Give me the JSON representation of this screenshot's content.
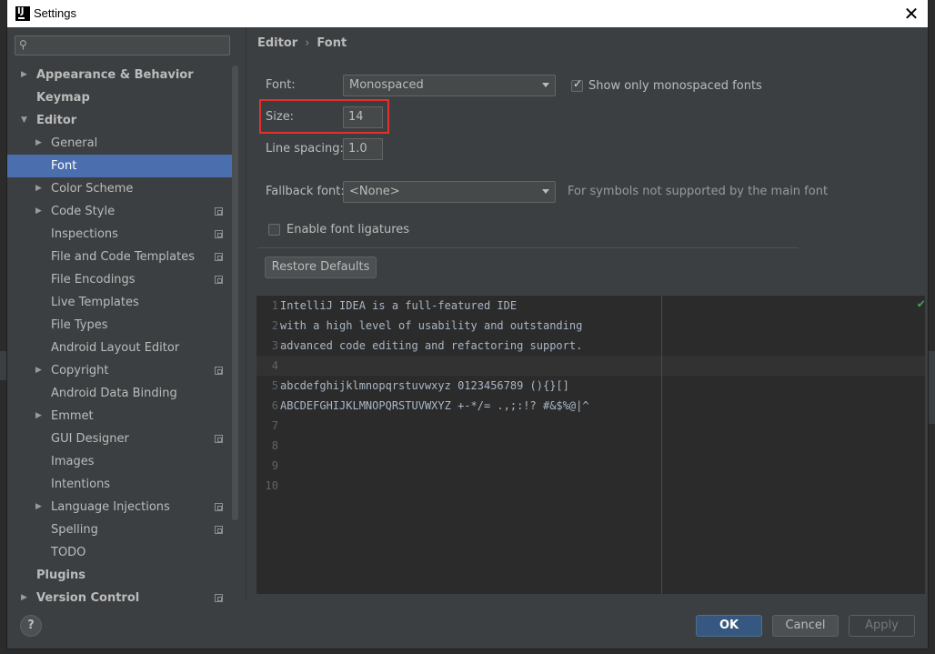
{
  "window": {
    "title": "Settings"
  },
  "sidebar": {
    "search_placeholder": "",
    "items": [
      {
        "label": "Appearance & Behavior",
        "level": 0,
        "expandable": true,
        "expanded": false,
        "bold": true,
        "project_icon": false
      },
      {
        "label": "Keymap",
        "level": 0,
        "expandable": false,
        "bold": true,
        "project_icon": false
      },
      {
        "label": "Editor",
        "level": 0,
        "expandable": true,
        "expanded": true,
        "bold": true,
        "project_icon": false
      },
      {
        "label": "General",
        "level": 1,
        "expandable": true,
        "project_icon": false
      },
      {
        "label": "Font",
        "level": 1,
        "expandable": false,
        "selected": true,
        "project_icon": false
      },
      {
        "label": "Color Scheme",
        "level": 1,
        "expandable": true,
        "project_icon": false
      },
      {
        "label": "Code Style",
        "level": 1,
        "expandable": true,
        "project_icon": true
      },
      {
        "label": "Inspections",
        "level": 1,
        "expandable": false,
        "project_icon": true
      },
      {
        "label": "File and Code Templates",
        "level": 1,
        "expandable": false,
        "project_icon": true
      },
      {
        "label": "File Encodings",
        "level": 1,
        "expandable": false,
        "project_icon": true
      },
      {
        "label": "Live Templates",
        "level": 1,
        "expandable": false,
        "project_icon": false
      },
      {
        "label": "File Types",
        "level": 1,
        "expandable": false,
        "project_icon": false
      },
      {
        "label": "Android Layout Editor",
        "level": 1,
        "expandable": false,
        "project_icon": false
      },
      {
        "label": "Copyright",
        "level": 1,
        "expandable": true,
        "project_icon": true
      },
      {
        "label": "Android Data Binding",
        "level": 1,
        "expandable": false,
        "project_icon": false
      },
      {
        "label": "Emmet",
        "level": 1,
        "expandable": true,
        "project_icon": false
      },
      {
        "label": "GUI Designer",
        "level": 1,
        "expandable": false,
        "project_icon": true
      },
      {
        "label": "Images",
        "level": 1,
        "expandable": false,
        "project_icon": false
      },
      {
        "label": "Intentions",
        "level": 1,
        "expandable": false,
        "project_icon": false
      },
      {
        "label": "Language Injections",
        "level": 1,
        "expandable": true,
        "project_icon": true
      },
      {
        "label": "Spelling",
        "level": 1,
        "expandable": false,
        "project_icon": true
      },
      {
        "label": "TODO",
        "level": 1,
        "expandable": false,
        "project_icon": false
      },
      {
        "label": "Plugins",
        "level": 0,
        "expandable": false,
        "bold": true,
        "project_icon": false
      },
      {
        "label": "Version Control",
        "level": 0,
        "expandable": true,
        "bold": true,
        "project_icon": true
      }
    ]
  },
  "breadcrumb": {
    "parent": "Editor",
    "separator": "›",
    "current": "Font"
  },
  "font_settings": {
    "font_label": "Font:",
    "font_value": "Monospaced",
    "show_monospaced_label": "Show only monospaced fonts",
    "show_monospaced_checked": true,
    "size_label": "Size:",
    "size_value": "14",
    "line_spacing_label": "Line spacing:",
    "line_spacing_value": "1.0",
    "fallback_label": "Fallback font:",
    "fallback_value": "<None>",
    "fallback_hint": "For symbols not supported by the main font",
    "ligatures_label": "Enable font ligatures",
    "ligatures_checked": false,
    "restore_label": "Restore Defaults"
  },
  "preview": {
    "line_numbers": [
      "1",
      "2",
      "3",
      "4",
      "5",
      "6",
      "7",
      "8",
      "9",
      "10"
    ],
    "lines": [
      "IntelliJ IDEA is a full-featured IDE",
      "with a high level of usability and outstanding",
      "advanced code editing and refactoring support.",
      "",
      "abcdefghijklmnopqrstuvwxyz 0123456789 (){}[]",
      "ABCDEFGHIJKLMNOPQRSTUVWXYZ +-*/= .,;:!? #&$%@|^",
      "",
      "",
      "",
      ""
    ]
  },
  "buttons": {
    "ok": "OK",
    "cancel": "Cancel",
    "apply": "Apply",
    "help": "?"
  },
  "colors": {
    "accent": "#4b6eaf",
    "highlight": "#e0312f",
    "ok_primary": "#365880"
  }
}
